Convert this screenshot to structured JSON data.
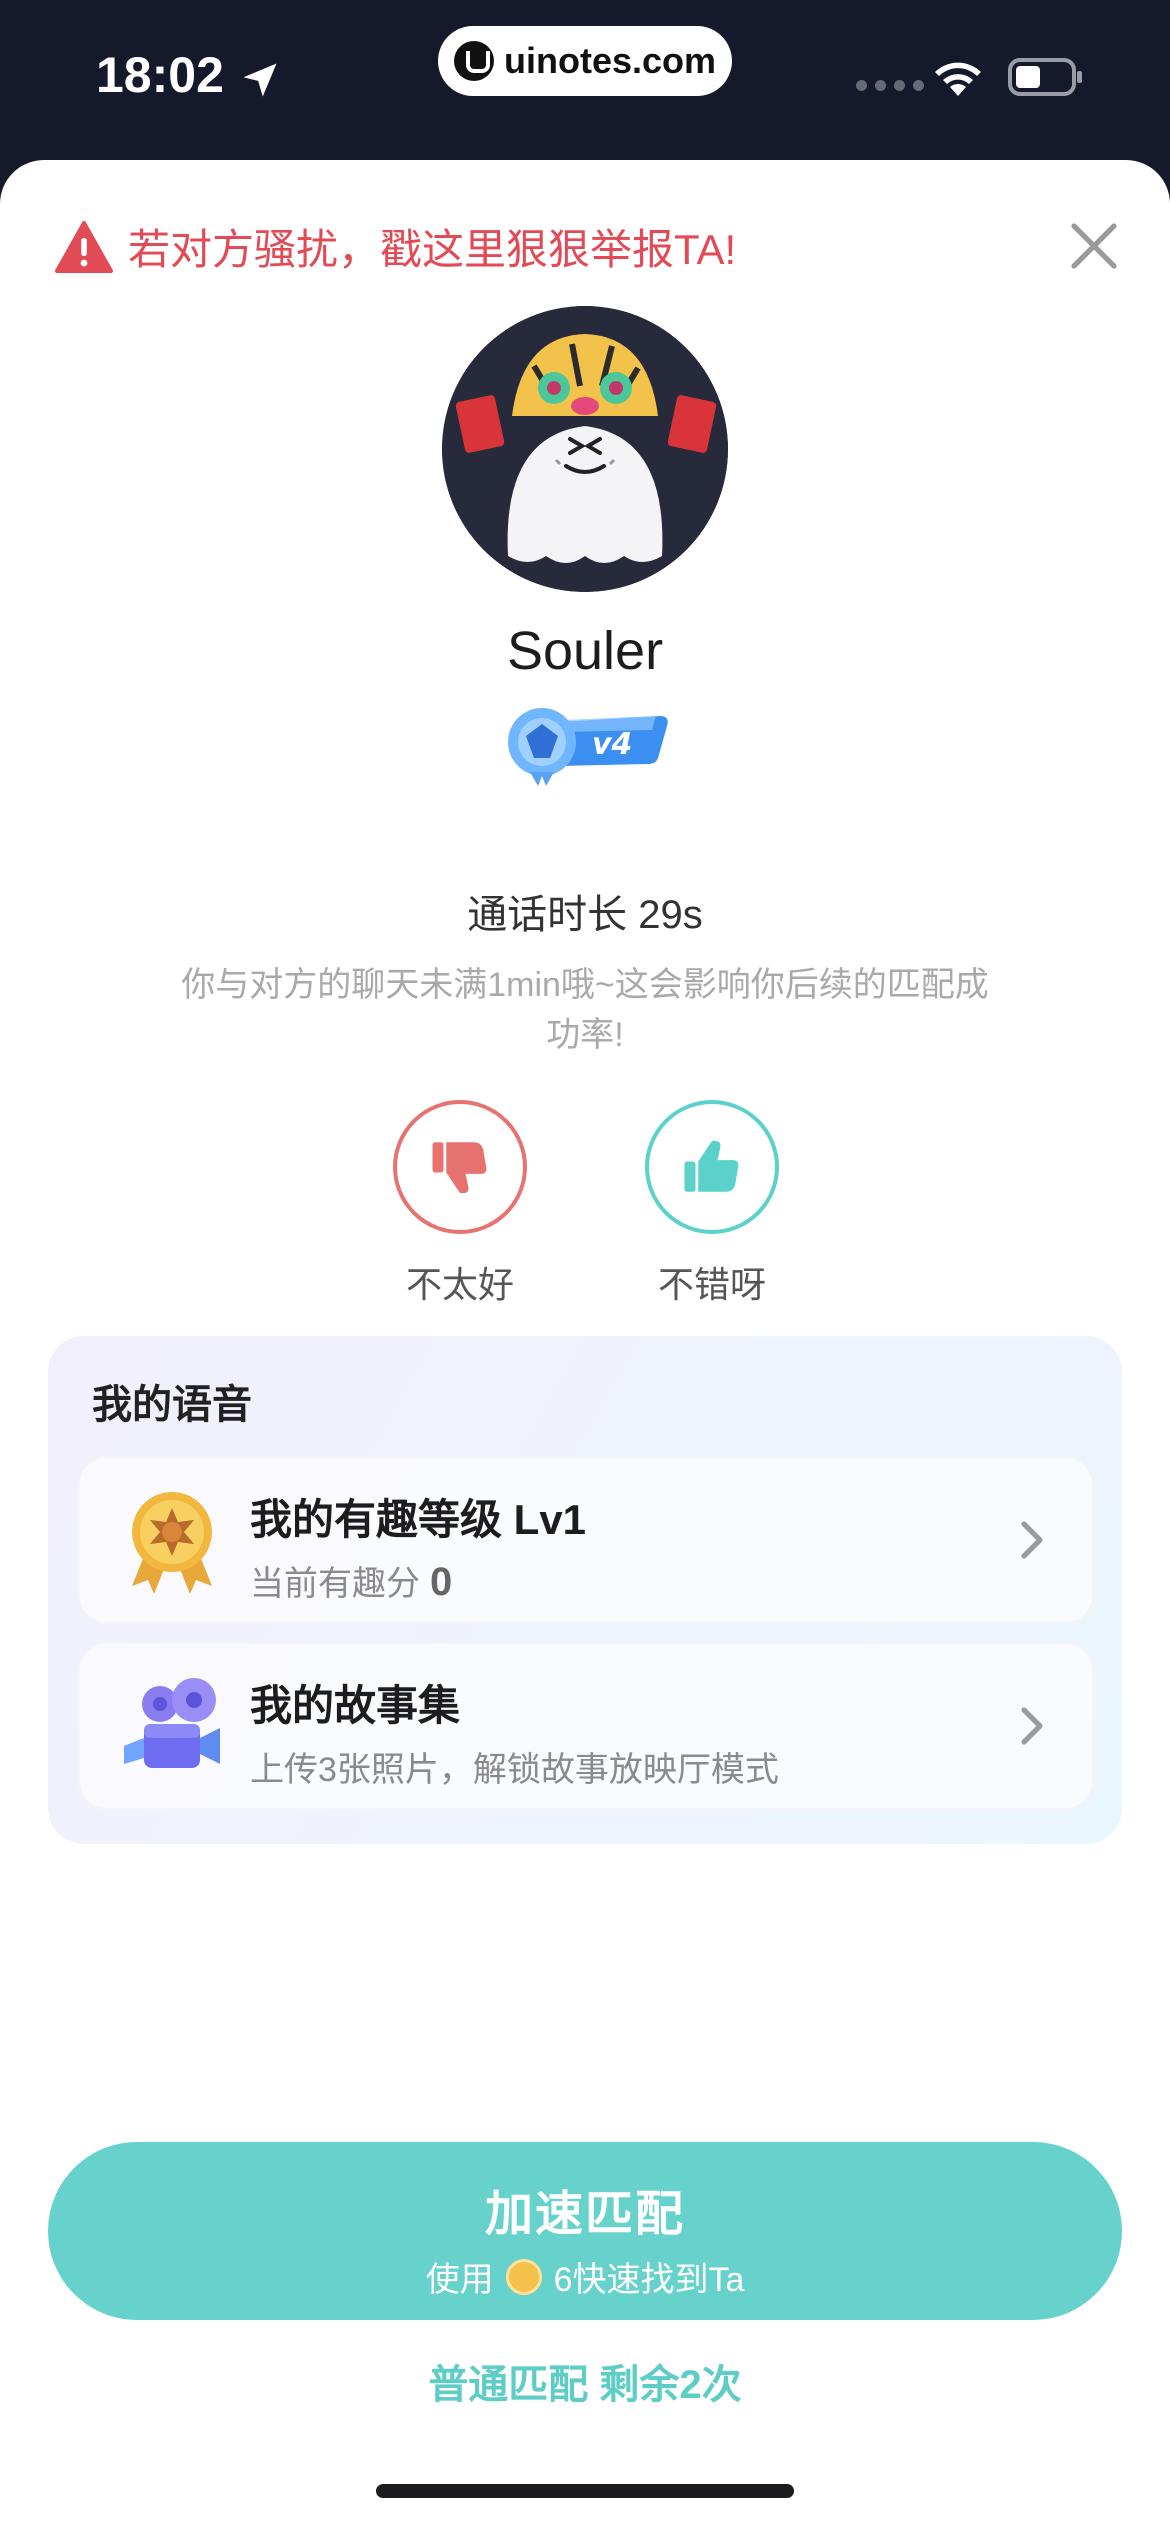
{
  "status": {
    "time": "18:02"
  },
  "browser": {
    "url": "uinotes.com"
  },
  "report": {
    "text": "若对方骚扰，戳这里狠狠举报TA!"
  },
  "profile": {
    "name": "Souler",
    "level_badge": "v4"
  },
  "call": {
    "duration": "通话时长 29s",
    "hint": "你与对方的聊天未满1min哦~这会影响你后续的匹配成功率!"
  },
  "rating": {
    "bad_label": "不太好",
    "good_label": "不错呀"
  },
  "voice": {
    "title": "我的语音",
    "items": [
      {
        "title": "我的有趣等级 Lv1",
        "sub_label": "当前有趣分",
        "sub_value": "0"
      },
      {
        "title": "我的故事集",
        "sub_label": "上传3张照片，解锁故事放映厅模式"
      }
    ]
  },
  "speed_match": {
    "title": "加速匹配",
    "sub_prefix": "使用",
    "sub_suffix": "6快速找到Ta"
  },
  "normal_match": {
    "text": "普通匹配 剩余2次"
  },
  "colors": {
    "accent": "#67d2cc",
    "warning": "#e24a55",
    "dislike": "#e8726f",
    "like": "#5ad1cb"
  }
}
